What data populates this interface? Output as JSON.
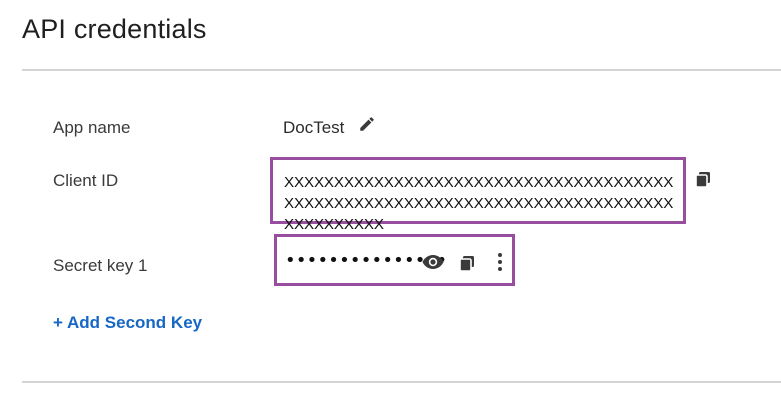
{
  "page": {
    "title": "API credentials"
  },
  "fields": {
    "app_name": {
      "label": "App name",
      "value": "DocTest"
    },
    "client_id": {
      "label": "Client ID",
      "value": "XXXXXXXXXXXXXXXXXXXXXXXXXXXXXXXXXXXXXXXXXXXXXXXXXXXXXXXXXXXXXXXXXXXXXXXXXXXXXXXXXXXXXXXX"
    },
    "secret_key_1": {
      "label": "Secret key 1",
      "value": "•••••••••••••••"
    }
  },
  "actions": {
    "add_second_key": "+ Add Second Key"
  },
  "icons": {
    "edit": "pencil-icon",
    "copy": "copy-icon",
    "show": "eye-icon",
    "more": "kebab-menu-icon"
  },
  "colors": {
    "highlight_border": "#984e9f",
    "link": "#1767c6",
    "icon": "#3a3a3a"
  }
}
